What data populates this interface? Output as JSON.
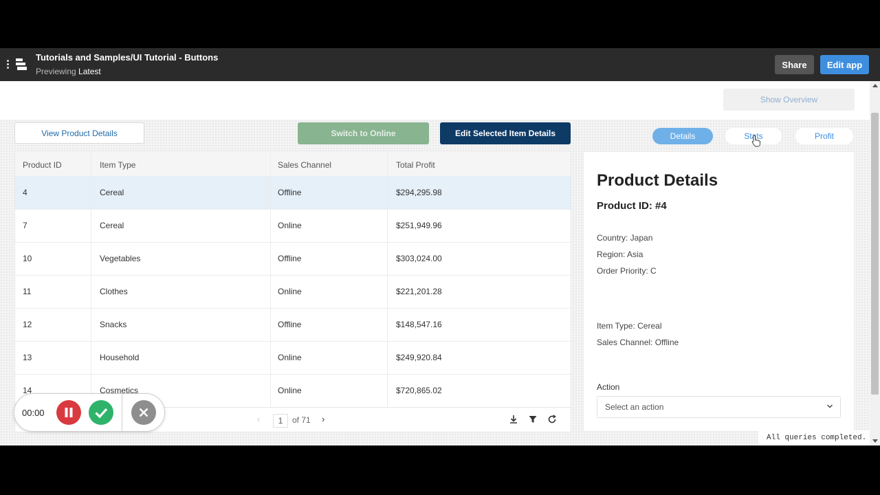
{
  "app": {
    "title": "Tutorials and Samples/UI Tutorial - Buttons",
    "preview_prefix": "Previewing",
    "preview_version": "Latest",
    "share_label": "Share",
    "edit_label": "Edit app"
  },
  "toolbar": {
    "show_overview": "Show Overview",
    "view_details": "View Product Details",
    "switch_online": "Switch to Online",
    "edit_selected": "Edit Selected Item Details"
  },
  "table": {
    "columns": [
      "Product ID",
      "Item Type",
      "Sales Channel",
      "Total Profit"
    ],
    "rows": [
      [
        "4",
        "Cereal",
        "Offline",
        "$294,295.98"
      ],
      [
        "7",
        "Cereal",
        "Online",
        "$251,949.96"
      ],
      [
        "10",
        "Vegetables",
        "Offline",
        "$303,024.00"
      ],
      [
        "11",
        "Clothes",
        "Online",
        "$221,201.28"
      ],
      [
        "12",
        "Snacks",
        "Offline",
        "$148,547.16"
      ],
      [
        "13",
        "Household",
        "Online",
        "$249,920.84"
      ],
      [
        "14",
        "Cosmetics",
        "Online",
        "$720,865.02"
      ]
    ],
    "selected_row": 0,
    "page": "1",
    "page_of": "of 71"
  },
  "tabs": {
    "details": "Details",
    "stats": "Stats",
    "profit": "Profit",
    "active": "Details"
  },
  "panel": {
    "title": "Product Details",
    "subtitle": "Product ID: #4",
    "country": "Country: Japan",
    "region": "Region: Asia",
    "priority": "Order Priority: C",
    "item_type": "Item Type: Cereal",
    "channel": "Sales Channel: Offline",
    "action_label": "Action",
    "action_placeholder": "Select an action"
  },
  "status": "All queries completed.",
  "recorder": {
    "time": "00:00"
  },
  "colors": {
    "primary": "#3e8ee0",
    "dark_button": "#0e3a66",
    "green_button": "#88b490",
    "selected_row": "#e5f0f9"
  }
}
